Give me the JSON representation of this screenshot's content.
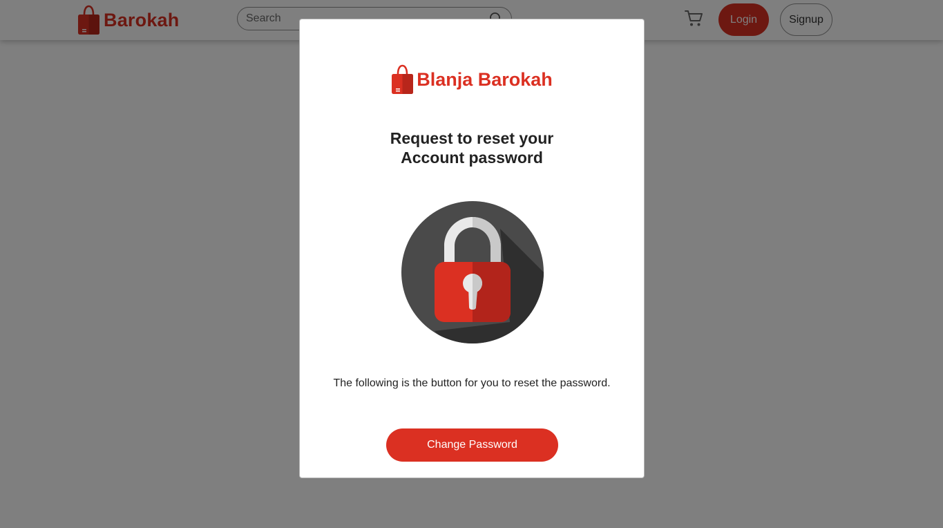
{
  "navbar": {
    "brand": "Barokah",
    "search": {
      "placeholder": "Search",
      "value": ""
    },
    "login_label": "Login",
    "signup_label": "Signup"
  },
  "modal": {
    "brand": "Blanja Barokah",
    "title_line1": "Request to reset your",
    "title_line2": "Account password",
    "description": "The following is the button for you to reset the password.",
    "button_label": "Change Password",
    "illustration": "lock-icon"
  },
  "colors": {
    "brand_red": "#db3022",
    "backdrop": "rgba(0,0,0,0.5)",
    "text_dark": "#222222"
  }
}
